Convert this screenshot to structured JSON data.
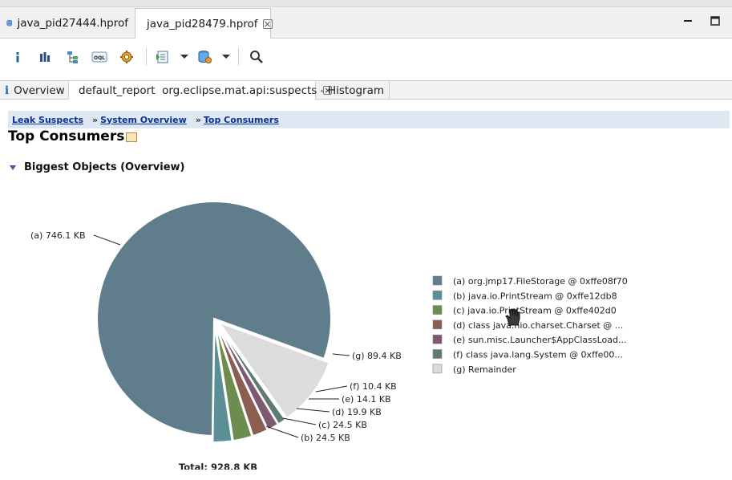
{
  "editor_tabs": [
    {
      "label": "java_pid27444.hprof",
      "active": false
    },
    {
      "label": "java_pid28479.hprof",
      "active": true,
      "closable": true
    }
  ],
  "toolbar": {
    "buttons": [
      "info-icon",
      "histogram-icon",
      "dominator-tree-icon",
      "oql-icon",
      "settings-gear-icon",
      "run-report-icon",
      "query-browser-icon",
      "search-icon"
    ]
  },
  "inner_tabs": [
    {
      "label": "Overview",
      "icon": "info-icon"
    },
    {
      "label": "default_report  org.eclipse.mat.api:suspects",
      "icon": "database-icon",
      "active": true,
      "closable": true
    },
    {
      "label": "Histogram",
      "icon": "histogram-icon"
    }
  ],
  "breadcrumb": [
    {
      "label": "Leak Suspects"
    },
    {
      "label": "System Overview",
      "prefix": "»"
    },
    {
      "label": "Top Consumers",
      "prefix": "»"
    }
  ],
  "page": {
    "title": "Top Consumers",
    "section_title": "Biggest Objects (Overview)"
  },
  "chart_data": {
    "type": "pie",
    "title": "",
    "total_label": "Total: 928.8 KB",
    "unit": "KB",
    "slices": [
      {
        "key": "(a)",
        "label": "746.1 KB",
        "value": 746.1,
        "legend": "org.jmp17.FileStorage @ 0xffe08f70",
        "color": "#607d8b"
      },
      {
        "key": "(b)",
        "label": "24.5 KB",
        "value": 24.5,
        "legend": "java.io.PrintStream @ 0xffe12db8",
        "color": "#5b8f96"
      },
      {
        "key": "(c)",
        "label": "24.5 KB",
        "value": 24.5,
        "legend": "java.io.PrintStream @ 0xffe402d0",
        "color": "#6f8c4f"
      },
      {
        "key": "(d)",
        "label": "19.9 KB",
        "value": 19.9,
        "legend": "class java.nio.charset.Charset @ ...",
        "color": "#8b5e52"
      },
      {
        "key": "(e)",
        "label": "14.1 KB",
        "value": 14.1,
        "legend": "sun.misc.Launcher$AppClassLoad...",
        "color": "#7d5a72"
      },
      {
        "key": "(f)",
        "label": "10.4 KB",
        "value": 10.4,
        "legend": "class java.lang.System @ 0xffe00...",
        "color": "#5f7a70"
      },
      {
        "key": "(g)",
        "label": "89.4 KB",
        "value": 89.4,
        "legend": "Remainder",
        "color": "#dcdcdc"
      }
    ],
    "legend_placement": "right"
  }
}
